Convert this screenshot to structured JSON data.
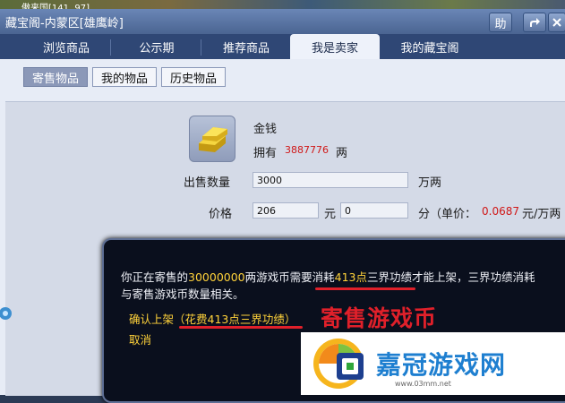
{
  "window": {
    "scene_text": "傲来国[141, 97]",
    "title": "藏宝阁-内蒙区[雄鹰岭]",
    "help_label": "助"
  },
  "tabs": [
    {
      "label": "浏览商品"
    },
    {
      "label": "公示期"
    },
    {
      "label": "推荐商品"
    },
    {
      "label": "我是卖家"
    },
    {
      "label": "我的藏宝阁"
    }
  ],
  "subtabs": [
    {
      "label": "寄售物品"
    },
    {
      "label": "我的物品"
    },
    {
      "label": "历史物品"
    }
  ],
  "item": {
    "name": "金钱",
    "own_label": "拥有",
    "own_amount": "3887776",
    "own_unit": "两"
  },
  "form": {
    "qty_label": "出售数量",
    "qty_value": "3000",
    "qty_unit": "万两",
    "price_label": "价格",
    "price_yuan": "206",
    "yuan_unit": "元",
    "price_fen": "0",
    "fen_unit": "分（单价：",
    "unit_price": "0.0687",
    "unit_price_suffix": "元/万两"
  },
  "dialog": {
    "l1_a": "你正在寄售的",
    "l1_amount": "30000000",
    "l1_b": "两游戏币需要消耗",
    "l1_points": "413点",
    "l1_c": "三界功绩才能上架，三界功绩消耗",
    "l2": "与寄售游戏币数量相关。",
    "confirm": "确认上架（花费413点三界功绩）",
    "cancel": "取消"
  },
  "annotation": {
    "text": "寄售游戏币"
  },
  "watermark": {
    "name": "嘉冠游戏网",
    "url": "www.03mm.net"
  },
  "colors": {
    "accent_red": "#e0202a",
    "amount_red": "#d01818",
    "dialog_yellow": "#ffd23a",
    "tab_bar": "#2f4775"
  }
}
